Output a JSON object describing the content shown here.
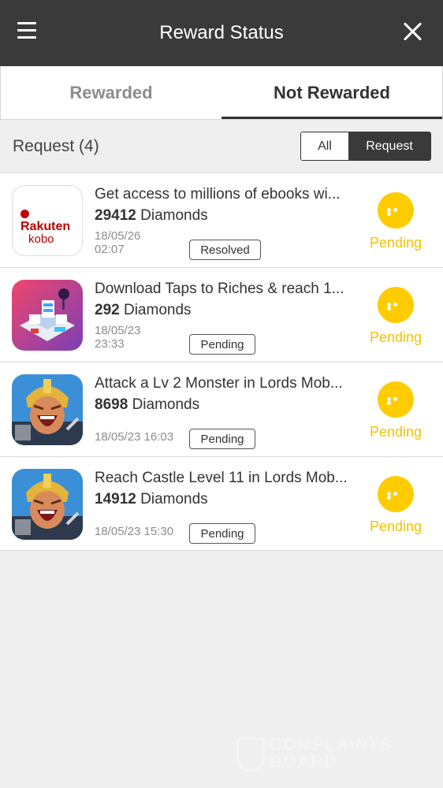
{
  "header": {
    "title": "Reward Status"
  },
  "tabs": [
    {
      "label": "Rewarded",
      "active": false
    },
    {
      "label": "Not Rewarded",
      "active": true
    }
  ],
  "request_header": {
    "title": "Request (4)",
    "filters": [
      {
        "label": "All",
        "selected": false
      },
      {
        "label": "Request",
        "selected": true
      }
    ]
  },
  "items": [
    {
      "icon": "rakuten-kobo-logo",
      "icon_text": "Rakuten kobo",
      "title": "Get access to millions of ebooks wi...",
      "amount": "29412",
      "unit": "Diamonds",
      "date": "18/05/26 02:07",
      "badge": "Resolved",
      "status": "Pending"
    },
    {
      "icon": "taps-to-riches-icon",
      "title": "Download Taps to Riches & reach 1...",
      "amount": "292",
      "unit": "Diamonds",
      "date": "18/05/23 23:33",
      "badge": "Pending",
      "status": "Pending"
    },
    {
      "icon": "lords-mobile-icon",
      "title": "Attack a Lv 2 Monster in Lords Mob...",
      "amount": "8698",
      "unit": "Diamonds",
      "date": "18/05/23 16:03",
      "badge": "Pending",
      "status": "Pending"
    },
    {
      "icon": "lords-mobile-icon",
      "title": "Reach Castle Level 11 in Lords Mob...",
      "amount": "14912",
      "unit": "Diamonds",
      "date": "18/05/23 15:30",
      "badge": "Pending",
      "status": "Pending"
    }
  ],
  "watermark": {
    "text": "COMPLAINTS BOARD"
  },
  "colors": {
    "topbar": "#3a3a3a",
    "pending": "#ffcc00",
    "kobo_red": "#bf0000"
  }
}
